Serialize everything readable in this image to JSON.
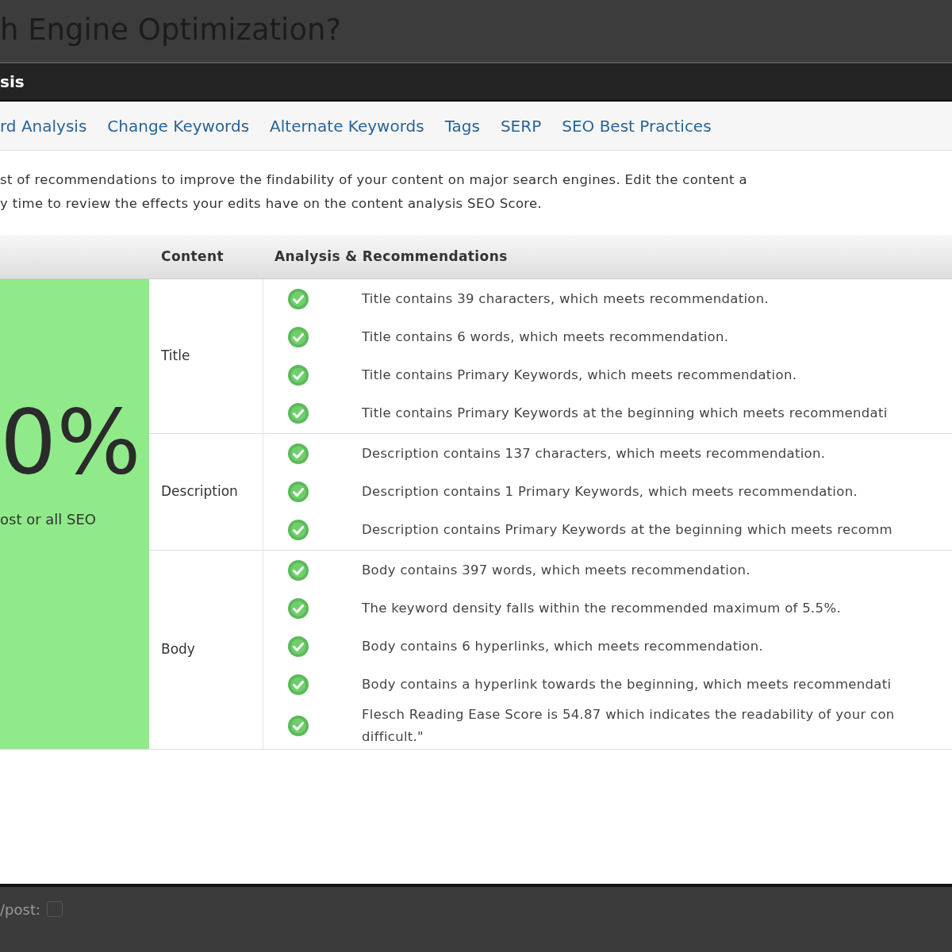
{
  "page_title": "h Engine Optimization?",
  "panel": {
    "title": "sis"
  },
  "tabs": [
    {
      "label": "rd Analysis",
      "selected": false
    },
    {
      "label": "Change Keywords",
      "selected": false
    },
    {
      "label": "Alternate Keywords",
      "selected": false
    },
    {
      "label": "Tags",
      "selected": false
    },
    {
      "label": "SERP",
      "selected": false
    },
    {
      "label": "SEO Best Practices",
      "selected": false
    }
  ],
  "intro": [
    "st of recommendations to improve the findability of your content on major search engines. Edit the content a",
    "y time to review the effects your edits have on the content analysis SEO Score."
  ],
  "table": {
    "columns": [
      "Content",
      "Analysis & Recommendations"
    ],
    "score": {
      "value": "0%",
      "caption": "ost or all SEO"
    },
    "rows": [
      {
        "content": "Title",
        "items": [
          {
            "passed": true,
            "lines": [
              "Title contains 39 characters, which meets recommendation."
            ]
          },
          {
            "passed": true,
            "lines": [
              "Title contains 6 words, which meets recommendation."
            ]
          },
          {
            "passed": true,
            "lines": [
              "Title contains Primary Keywords, which meets recommendation."
            ]
          },
          {
            "passed": true,
            "lines": [
              "Title contains Primary Keywords at the beginning which meets recommendati"
            ]
          }
        ]
      },
      {
        "content": "Description",
        "items": [
          {
            "passed": true,
            "lines": [
              "Description contains 137 characters, which meets recommendation."
            ]
          },
          {
            "passed": true,
            "lines": [
              "Description contains 1 Primary Keywords, which meets recommendation."
            ]
          },
          {
            "passed": true,
            "lines": [
              "Description contains Primary Keywords at the beginning which meets recomm"
            ]
          }
        ]
      },
      {
        "content": "Body",
        "items": [
          {
            "passed": true,
            "lines": [
              "Body contains 397 words, which meets recommendation."
            ]
          },
          {
            "passed": true,
            "lines": [
              "The keyword density falls within the recommended maximum of 5.5%."
            ]
          },
          {
            "passed": true,
            "lines": [
              "Body contains 6 hyperlinks, which meets recommendation."
            ]
          },
          {
            "passed": true,
            "lines": [
              "Body contains a hyperlink towards the beginning, which meets recommendati"
            ]
          },
          {
            "passed": true,
            "lines": [
              "Flesch Reading Ease Score is 54.87 which indicates the readability of your con",
              "difficult.\""
            ]
          }
        ]
      }
    ]
  },
  "footer": {
    "label": "/post:",
    "checked": false
  }
}
